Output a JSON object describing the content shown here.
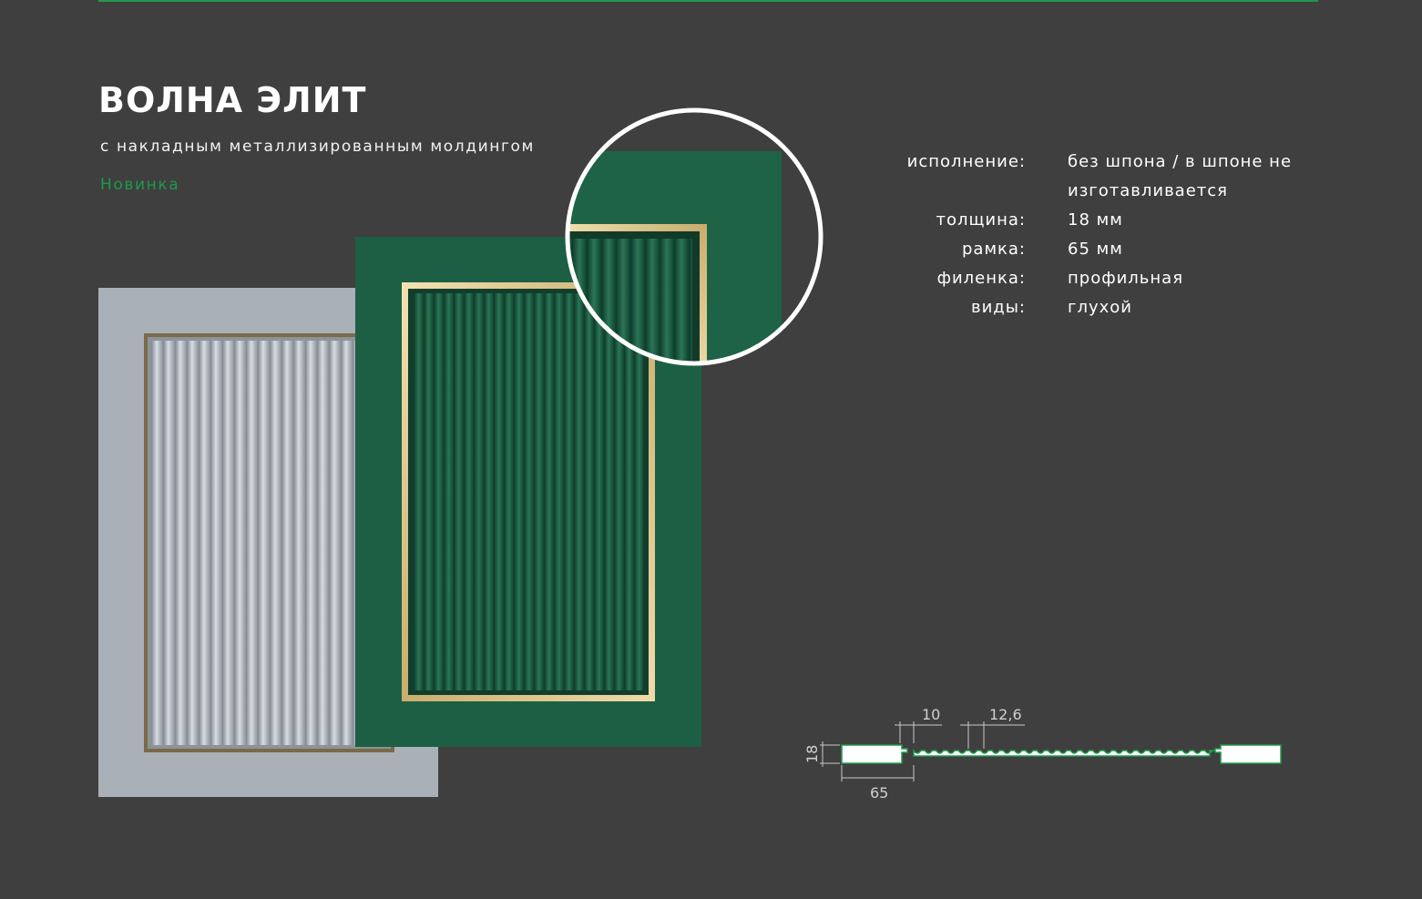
{
  "product": {
    "title": "ВОЛНА ЭЛИТ",
    "subtitle": "с накладным металлизированным молдингом",
    "badge": "Новинка"
  },
  "specs": [
    {
      "label": "исполнение:",
      "value": "без шпона / в шпоне не изготавливается"
    },
    {
      "label": "толщина:",
      "value": "18 мм"
    },
    {
      "label": "рамка:",
      "value": "65 мм"
    },
    {
      "label": "филенка:",
      "value": "профильная"
    },
    {
      "label": "виды:",
      "value": "глухой"
    }
  ],
  "profile_dimensions": {
    "groove_width": "10",
    "wave_pitch": "12,6",
    "thickness": "18",
    "frame_width": "65"
  },
  "colors": {
    "accent": "#1e9a4a",
    "background": "#3f3f3f",
    "door_green": "#1d5f44",
    "door_grey": "#a9b0b8",
    "molding_gold": "#d6c08a"
  }
}
